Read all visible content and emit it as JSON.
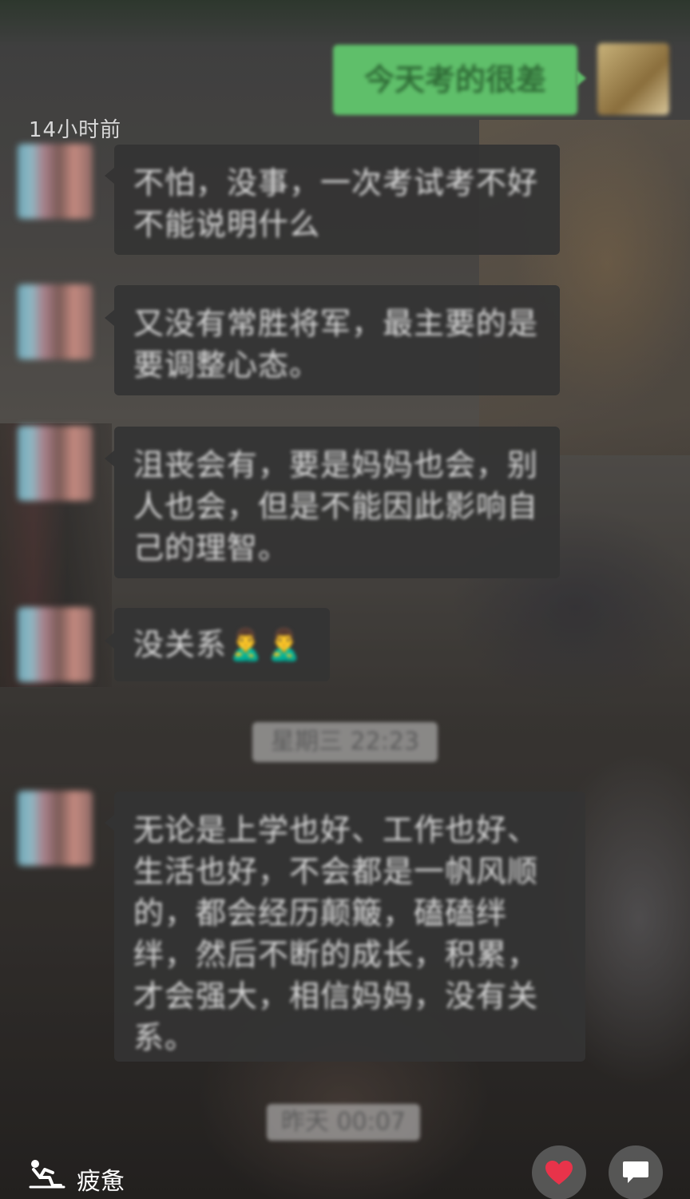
{
  "moment": {
    "timestamp": "14小时前"
  },
  "chat": {
    "sent": [
      {
        "text": "今天考的很差"
      }
    ],
    "received": [
      {
        "text": "不怕，没事，一次考试考不好不能说明什么"
      },
      {
        "text": "又没有常胜将军，最主要的是要调整心态。"
      },
      {
        "text": "沮丧会有，要是妈妈也会，别人也会，但是不能因此影响自己的理智。"
      },
      {
        "text": "没关系🙎‍♂️🙎‍♂️"
      },
      {
        "text": "无论是上学也好、工作也好、生活也好，不会都是一帆风顺的，都会经历颠簸，磕磕绊绊，然后不断的成长，积累，才会强大，相信妈妈，没有关系。"
      }
    ],
    "time_dividers": [
      {
        "text": "星期三 22:23"
      },
      {
        "text": "昨天 00:07"
      }
    ]
  },
  "footer": {
    "mood_icon": "tired-person-icon",
    "mood_label": "疲惫",
    "like_icon": "heart-icon",
    "comment_icon": "comment-icon",
    "like_color": "#e8334a"
  }
}
